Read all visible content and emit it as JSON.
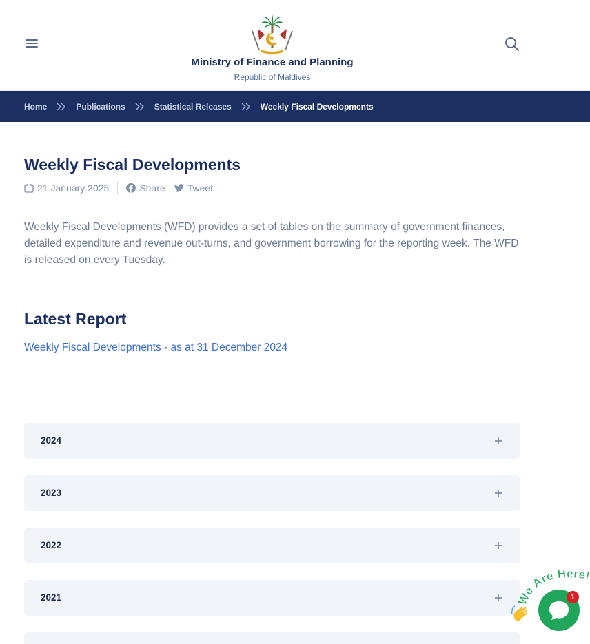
{
  "header": {
    "org_name": "Ministry of Finance and Planning",
    "org_sub": "Republic of Maldives"
  },
  "breadcrumb": {
    "items": [
      "Home",
      "Publications",
      "Statistical Releases",
      "Weekly Fiscal Developments"
    ]
  },
  "article": {
    "title": "Weekly Fiscal Developments",
    "date": "21 January 2025",
    "share_label": "Share",
    "tweet_label": "Tweet",
    "description": "Weekly Fiscal Developments (WFD) provides a set of tables on the summary of government finances, detailed expenditure and revenue out-turns, and government borrowing for the reporting week. The WFD is released on every Tuesday."
  },
  "latest": {
    "heading": "Latest Report",
    "link_text": "Weekly Fiscal Developments - as at 31 December 2024"
  },
  "accordion": {
    "years": [
      "2024",
      "2023",
      "2022",
      "2021"
    ]
  },
  "chat_widget": {
    "banner_text": "We Are Here!",
    "badge_count": "1"
  },
  "colors": {
    "brand_navy": "#1b2f63",
    "link_blue": "#3a6fd6",
    "accordion_bg": "#f1f4f9",
    "chat_green": "#1fa65a",
    "badge_red": "#d81f26"
  }
}
